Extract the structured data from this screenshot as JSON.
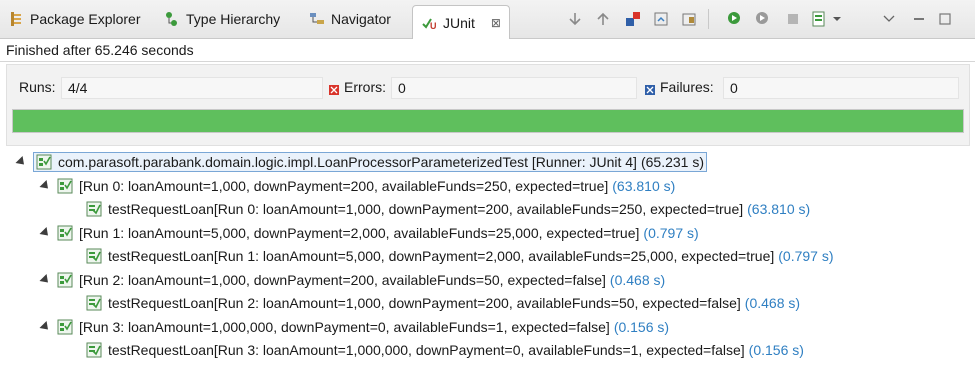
{
  "tabs": {
    "package_explorer": "Package Explorer",
    "type_hierarchy": "Type Hierarchy",
    "navigator": "Navigator",
    "junit": "JUnit",
    "close_symbol": "⊠"
  },
  "status": {
    "text": "Finished after 65.246 seconds"
  },
  "counters": {
    "runs_label": "Runs:",
    "runs_value": "4/4",
    "errors_label": "Errors:",
    "errors_value": "0",
    "failures_label": "Failures:",
    "failures_value": "0",
    "progress_fraction": 1.0,
    "progress_color": "#5fbf5d"
  },
  "tree": {
    "root": {
      "label": "com.parasoft.parabank.domain.logic.impl.LoanProcessorParameterizedTest [Runner: JUnit 4]",
      "time": "(65.231 s)"
    },
    "runs": [
      {
        "label": "[Run 0: loanAmount=1,000, downPayment=200, availableFunds=250, expected=true]",
        "time": "(63.810 s)",
        "test": {
          "label": "testRequestLoan[Run 0: loanAmount=1,000, downPayment=200, availableFunds=250, expected=true]",
          "time": "(63.810 s)"
        }
      },
      {
        "label": "[Run 1: loanAmount=5,000, downPayment=2,000, availableFunds=25,000, expected=true]",
        "time": "(0.797 s)",
        "test": {
          "label": "testRequestLoan[Run 1: loanAmount=5,000, downPayment=2,000, availableFunds=25,000, expected=true]",
          "time": "(0.797 s)"
        }
      },
      {
        "label": "[Run 2: loanAmount=1,000, downPayment=200, availableFunds=50, expected=false]",
        "time": "(0.468 s)",
        "test": {
          "label": "testRequestLoan[Run 2: loanAmount=1,000, downPayment=200, availableFunds=50, expected=false]",
          "time": "(0.468 s)"
        }
      },
      {
        "label": "[Run 3: loanAmount=1,000,000, downPayment=0, availableFunds=1, expected=false]",
        "time": "(0.156 s)",
        "test": {
          "label": "testRequestLoan[Run 3: loanAmount=1,000,000, downPayment=0, availableFunds=1, expected=false]",
          "time": "(0.156 s)"
        }
      }
    ]
  },
  "icons": {
    "package_explorer": "package-explorer-icon",
    "type_hierarchy": "type-hierarchy-icon",
    "navigator": "navigator-icon",
    "junit": "junit-icon",
    "next_failure": "arrow-down-icon",
    "previous_failure": "arrow-up-icon",
    "show_failures_only": "failures-only-icon",
    "scroll_lock": "scroll-lock-icon",
    "show_skipped": "skipped-icon",
    "rerun": "rerun-icon",
    "rerun_failed_first": "rerun-failed-icon",
    "stop": "stop-icon",
    "history": "history-icon",
    "history_dropdown": "chevron-down-icon",
    "view_menu": "view-menu-icon",
    "minimize": "minimize-icon",
    "maximize": "maximize-icon"
  },
  "colors": {
    "time_text": "#2f7fc2",
    "success_green": "#5fbf5d",
    "error_red": "#d9342b",
    "failure_blue": "#2f5fa8"
  }
}
